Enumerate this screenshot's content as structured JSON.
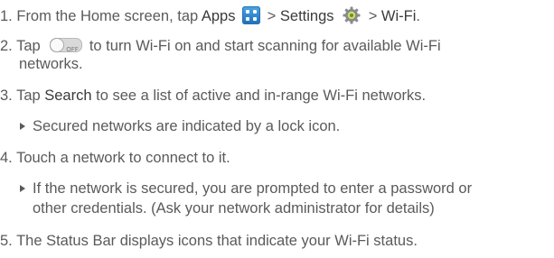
{
  "steps": {
    "s1": {
      "num": "1.",
      "pre": "From the Home screen, tap ",
      "apps": "Apps",
      "gt1": " > ",
      "settings": "Settings",
      "gt2": " > ",
      "wifi": "Wi-Fi",
      "end": "."
    },
    "s2": {
      "num": "2.",
      "pre": "Tap ",
      "toggle_text": "OFF",
      "line1": " to turn Wi-Fi on and start scanning for available Wi-Fi",
      "line2": "networks."
    },
    "s3": {
      "num": "3.",
      "pre": "Tap ",
      "search": "Search",
      "post": " to see a list of active and in-range Wi-Fi networks.",
      "bullet": "Secured networks are indicated by a lock icon."
    },
    "s4": {
      "num": "4.",
      "text": "Touch a network to connect to it.",
      "bullet_line1": "If the network is secured, you are prompted to enter a password or",
      "bullet_line2": "other credentials. (Ask your network administrator for details)"
    },
    "s5": {
      "num": "5.",
      "text": "The Status Bar displays icons that indicate your Wi-Fi status."
    }
  },
  "icons": {
    "apps": "apps-grid-icon",
    "settings": "settings-gear-icon",
    "toggle": "wifi-toggle-off-icon"
  },
  "colors": {
    "text": "#5a5a5a",
    "bold_text": "#3a3a3a",
    "apps_icon": "#2a84d2",
    "toggle_bg": "#d9d9d9"
  }
}
